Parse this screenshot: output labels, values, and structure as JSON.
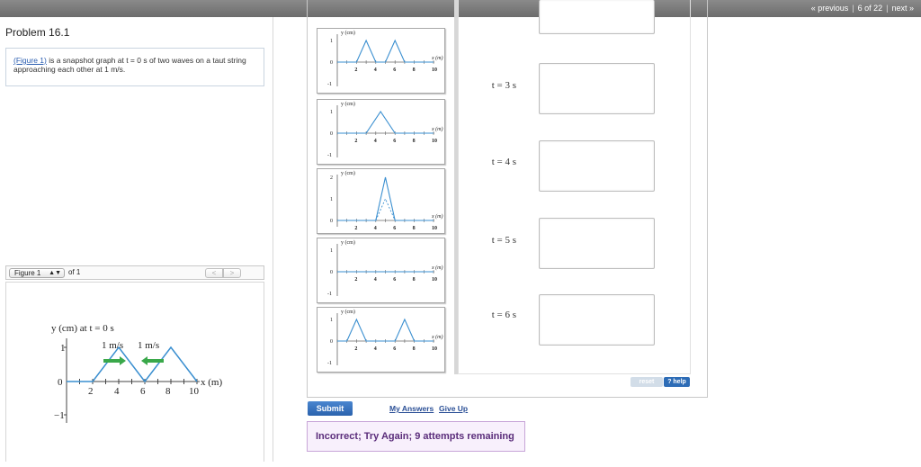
{
  "topnav": {
    "previous": "« previous",
    "position": "6 of 22",
    "next": "next »"
  },
  "problem": {
    "title": "Problem 16.1",
    "figure_link": "(Figure 1)",
    "description": " is a snapshot graph at t = 0 s of two waves on a taut string approaching each other at 1 m/s."
  },
  "figure_nav": {
    "selected": "Figure 1",
    "of_label": "of 1",
    "prev": "<",
    "next": ">"
  },
  "figure": {
    "ylabel": "y (cm) at t = 0 s",
    "xlabel": "x (m)",
    "y_ticks": [
      "1",
      "0",
      "−1"
    ],
    "x_ticks": [
      "2",
      "4",
      "6",
      "8",
      "10"
    ],
    "speed_left": "1 m/s",
    "speed_right": "1 m/s",
    "arrow_color": "#3aa84a",
    "wave_color": "#3a8fd0"
  },
  "graphs": {
    "ylabel": "y (cm)",
    "xlabel": "x (m)",
    "x_ticks": [
      "2",
      "4",
      "6",
      "8",
      "10"
    ],
    "y_top_1": "1",
    "y_top_2": "2",
    "y_zero": "0",
    "y_neg": "-1"
  },
  "answers": {
    "t3": "t = 3 s",
    "t4": "t = 4 s",
    "t5": "t = 5 s",
    "t6": "t = 6 s"
  },
  "buttons": {
    "reset": "reset",
    "help": "? help",
    "submit": "Submit",
    "my_answers": "My Answers",
    "give_up": "Give Up"
  },
  "feedback": "Incorrect; Try Again; 9 attempts remaining"
}
